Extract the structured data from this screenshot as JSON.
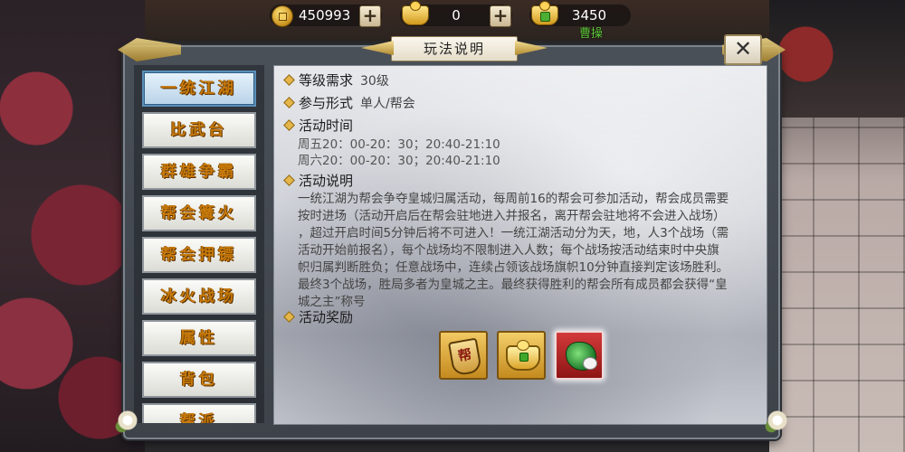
{
  "currency": {
    "gold": "450993",
    "yuanbao": "0",
    "bound_yuanbao": "3450",
    "plus": "+"
  },
  "player_name": "曹操",
  "dialog": {
    "title": "玩法说明",
    "close": "✕"
  },
  "sidebar": {
    "items": [
      {
        "label": "一统江湖",
        "active": true
      },
      {
        "label": "比武台",
        "active": false
      },
      {
        "label": "群雄争霸",
        "active": false
      },
      {
        "label": "帮会篝火",
        "active": false
      },
      {
        "label": "帮会押镖",
        "active": false
      },
      {
        "label": "冰火战场",
        "active": false
      },
      {
        "label": "属性",
        "active": false
      },
      {
        "label": "背包",
        "active": false
      },
      {
        "label": "帮派",
        "active": false
      }
    ]
  },
  "content": {
    "level_label": "等级需求",
    "level_value": "30级",
    "form_label": "参与形式",
    "form_value": "单人/帮会",
    "time_label": "活动时间",
    "time_lines": [
      "周五20：00-20：30；20:40-21:10",
      "周六20：00-20：30；20:40-21:10"
    ],
    "desc_label": "活动说明",
    "desc_lines": [
      "一统江湖为帮会争夺皇城归属活动，每周前16的帮会可参加活动，帮会成员需要",
      "按时进场（活动开启后在帮会驻地进入并报名，离开帮会驻地将不会进入战场）",
      "，超过开启时间5分钟后将不可进入！一统江湖活动分为天，地，人3个战场（需",
      "活动开始前报名），每个战场均不限制进入人数；每个战场按活动结束时中央旗",
      "帜归属判断胜负；任意战场中，连续占领该战场旗帜10分钟直接判定该场胜利。",
      "最终3个战场，胜局多者为皇城之主。最终获得胜利的帮会所有成员都会获得“皇",
      "城之主”称号"
    ],
    "reward_label": "活动奖励",
    "rewards": [
      {
        "icon": "gang-contribution-bag-icon",
        "glyph": "帮"
      },
      {
        "icon": "bound-yuanbao-ingot-icon"
      },
      {
        "icon": "title-jade-item-icon"
      }
    ]
  },
  "colors": {
    "sidebar_text": "#c87a0a",
    "active_tab": "#b9d3e8",
    "player_name": "#5ec83a"
  }
}
